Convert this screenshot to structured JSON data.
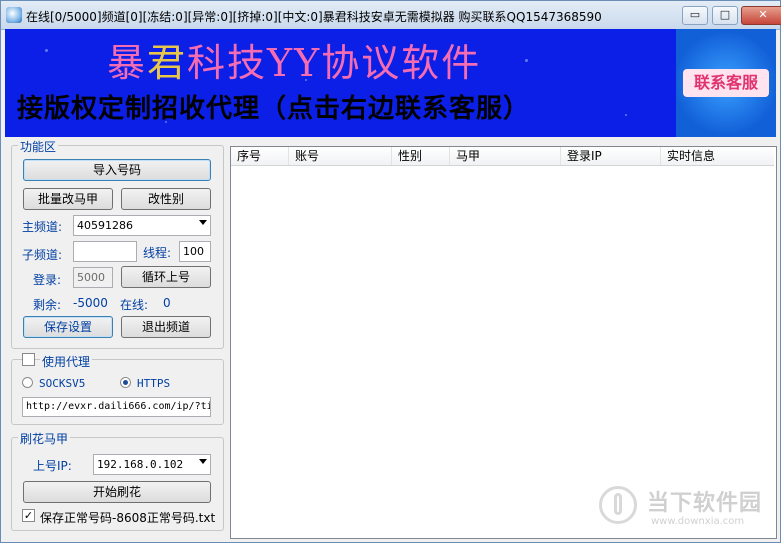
{
  "window": {
    "title": "在线[0/5000]频道[0][冻结:0][异常:0][挤掉:0][中文:0]暴君科技安卓无需模拟器 购买联系QQ1547368590",
    "minimize": "▭",
    "maximize": "□",
    "close": "✕"
  },
  "banner": {
    "title_part1": "暴",
    "title_part2": "君",
    "title_part3": "科技YY协议软件",
    "subtitle": "接版权定制招收代理（点击右边联系客服）",
    "contact_button": "联系客服"
  },
  "function_area": {
    "legend": "功能区",
    "import_button": "导入号码",
    "batch_vest_button": "批量改马甲",
    "gender_button": "改性别",
    "main_channel_label": "主频道:",
    "main_channel_value": "40591286",
    "sub_channel_label": "子频道:",
    "sub_channel_value": "",
    "threads_label": "线程:",
    "threads_value": "100",
    "login_label": "登录:",
    "login_value": "5000",
    "loop_login_button": "循环上号",
    "remaining_label": "剩余:",
    "remaining_value": "-5000",
    "online_label": "在线:",
    "online_value": "0",
    "save_settings_button": "保存设置",
    "exit_channel_button": "退出频道"
  },
  "proxy": {
    "use_proxy_label": "使用代理",
    "use_proxy_checked": false,
    "socks_label": "SOCKSV5",
    "https_label": "HTTPS",
    "selected": "HTTPS",
    "url_value": "http://evxr.daili666.com/ip/?ti"
  },
  "brush": {
    "legend": "刷花马甲",
    "ip_label": "上号IP:",
    "ip_value": "192.168.0.102",
    "start_button": "开始刷花",
    "save_label": "保存正常号码-8608正常号码.txt",
    "save_checked": true
  },
  "table": {
    "columns": [
      "序号",
      "账号",
      "性别",
      "马甲",
      "登录IP",
      "实时信息"
    ]
  },
  "watermark": {
    "text": "当下软件园",
    "url": "www.downxia.com"
  }
}
